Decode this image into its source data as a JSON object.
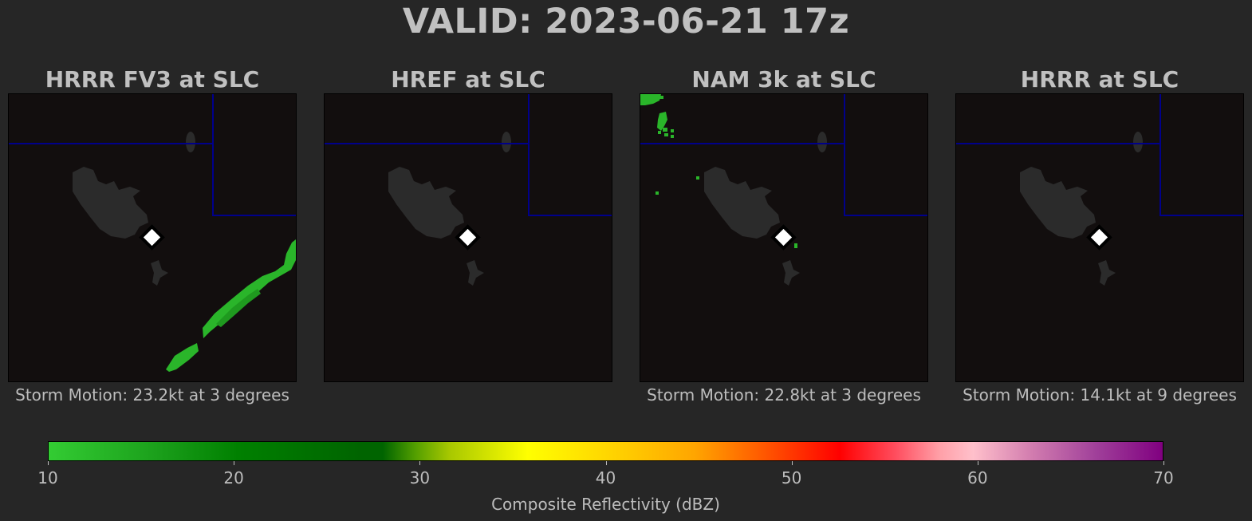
{
  "title": "VALID: 2023-06-21 17z",
  "panels": [
    {
      "title": "HRRR FV3 at SLC",
      "caption": "Storm Motion: 23.2kt at 3 degrees"
    },
    {
      "title": "HREF at SLC",
      "caption": ""
    },
    {
      "title": "NAM 3k at SLC",
      "caption": "Storm Motion: 22.8kt at 3 degrees"
    },
    {
      "title": "HRRR at SLC",
      "caption": "Storm Motion: 14.1kt at 9 degrees"
    }
  ],
  "colorbar": {
    "label": "Composite Reflectivity (dBZ)",
    "ticks": [
      "10",
      "20",
      "30",
      "40",
      "50",
      "60",
      "70"
    ],
    "min": 10,
    "max": 70
  },
  "colors": {
    "background": "#262626",
    "map_background": "#120e0e",
    "lake": "#2b2b2b",
    "state_border": "#00008b",
    "station_marker": "#ffffff",
    "echo": "#2ab52a"
  }
}
